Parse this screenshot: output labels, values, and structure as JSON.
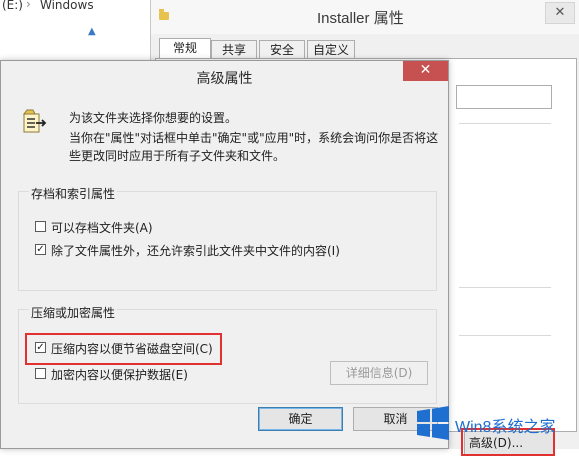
{
  "explorer": {
    "drive": "(E:)",
    "separator": "›",
    "folder": "Windows",
    "marker": "▲"
  },
  "properties_window": {
    "title": "Installer 属性",
    "close_glyph": "✕",
    "tabs": [
      {
        "label": "常规",
        "active": true
      },
      {
        "label": "共享",
        "active": false
      },
      {
        "label": "安全",
        "active": false
      },
      {
        "label": "自定义",
        "active": false
      }
    ],
    "advanced_button": "高级(D)..."
  },
  "dialog": {
    "title": "高级属性",
    "close_glyph": "✕",
    "intro": {
      "line1": "为该文件夹选择你想要的设置。",
      "line2": "当你在\"属性\"对话框中单击\"确定\"或\"应用\"时，系统会询问你是否将这",
      "line3": "些更改同时应用于所有子文件夹和文件。"
    },
    "archive_group": {
      "title": "存档和索引属性",
      "options": [
        {
          "label": "可以存档文件夹(A)",
          "checked": false
        },
        {
          "label": "除了文件属性外，还允许索引此文件夹中文件的内容(I)",
          "checked": true
        }
      ]
    },
    "compress_group": {
      "title": "压缩或加密属性",
      "options": [
        {
          "label": "压缩内容以便节省磁盘空间(C)",
          "checked": true
        },
        {
          "label": "加密内容以便保护数据(E)",
          "checked": false
        }
      ],
      "details_button": "详细信息(D)"
    },
    "ok_button": "确定",
    "cancel_button": "取消"
  },
  "watermark": {
    "text": "Win8系统之家"
  },
  "colors": {
    "highlight": "#e03030",
    "dialog_close": "#c75050",
    "watermark": "#1e6fd0"
  }
}
